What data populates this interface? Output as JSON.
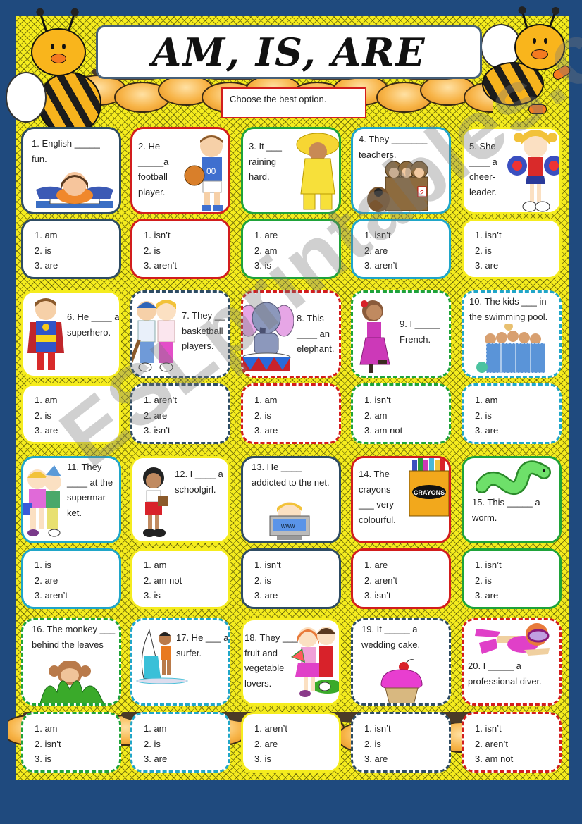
{
  "worksheet": {
    "title": "AM, IS, ARE",
    "instruction": "Choose the best option.",
    "watermark": "ESLprintables.com"
  },
  "colors": {
    "page_background": "#1f4a7e",
    "sheet_background": "#f5ec1e",
    "navy": "#2e4c63",
    "red": "#d21d1d",
    "green": "#1fa33a",
    "teal": "#20a6c8",
    "yellow": "#f5ec1e"
  },
  "questions": [
    {
      "number": 1,
      "prompt": "1. English _____ fun.",
      "picture": "girl-reading-book",
      "border_color": "navy",
      "border_style": "solid",
      "options": [
        "1. am",
        "2. is",
        "3. are"
      ]
    },
    {
      "number": 2,
      "prompt": "2. He _____a football player.",
      "picture": "boy-with-basketball",
      "border_color": "red",
      "border_style": "solid",
      "options": [
        "1. isn’t",
        "2. is",
        "3. aren’t"
      ]
    },
    {
      "number": 3,
      "prompt": "3. It ___ raining hard.",
      "picture": "child-in-raincoat",
      "border_color": "green",
      "border_style": "solid",
      "options": [
        "1. are",
        "2. am",
        "3. is"
      ]
    },
    {
      "number": 4,
      "prompt": "4. They _______ teachers.",
      "picture": "detectives-with-dog",
      "border_color": "teal",
      "border_style": "solid",
      "options": [
        "1. isn’t",
        "2. are",
        "3. aren’t"
      ]
    },
    {
      "number": 5,
      "prompt": "5. She ____ a cheer-leader.",
      "picture": "cheerleader",
      "border_color": "yellow",
      "border_style": "solid",
      "options": [
        "1. isn’t",
        "2. is",
        "3. are"
      ]
    },
    {
      "number": 6,
      "prompt": "6. He ____ a superhero.",
      "picture": "superhero-boy",
      "border_color": "yellow",
      "border_style": "solid",
      "options": [
        "1. am",
        "2. is",
        "3. are"
      ]
    },
    {
      "number": 7,
      "prompt": "7. They __ basketball players.",
      "picture": "baseball-kids",
      "border_color": "navy",
      "border_style": "dashed",
      "options": [
        "1. aren’t",
        "2. are",
        "3. isn’t"
      ]
    },
    {
      "number": 8,
      "prompt": "8. This ____ an elephant.",
      "picture": "circus-elephant",
      "border_color": "red",
      "border_style": "dashed",
      "options": [
        "1. am",
        "2. is",
        "3. are"
      ]
    },
    {
      "number": 9,
      "prompt": "9. I _____ French.",
      "picture": "flamenco-dancer",
      "border_color": "green",
      "border_style": "dashed",
      "options": [
        "1. isn’t",
        "2. am",
        "3. am not"
      ]
    },
    {
      "number": 10,
      "prompt": "10. The kids ___ in the swimming pool.",
      "picture": "kids-in-pool",
      "border_color": "teal",
      "border_style": "dashed",
      "options": [
        "1. am",
        "2. is",
        "3. are"
      ]
    },
    {
      "number": 11,
      "prompt": "11. They ____ at the supermar ket.",
      "picture": "shopping-kids",
      "border_color": "teal",
      "border_style": "solid",
      "options": [
        "1. is",
        "2. are",
        "3. aren’t"
      ]
    },
    {
      "number": 12,
      "prompt": "12. I ____ a schoolgirl.",
      "picture": "schoolgirl",
      "border_color": "yellow",
      "border_style": "solid",
      "options": [
        "1. am",
        "2. am not",
        "3. is"
      ]
    },
    {
      "number": 13,
      "prompt": "13. He ____ addicted to the net.",
      "picture": "kid-with-computer",
      "border_color": "navy",
      "border_style": "solid",
      "options": [
        "1. isn’t",
        "2. is",
        "3. are"
      ]
    },
    {
      "number": 14,
      "prompt": "14. The crayons ___ very colourful.",
      "picture": "crayon-box",
      "picture_label": "CRAYONS",
      "border_color": "red",
      "border_style": "solid",
      "options": [
        "1. are",
        "2. aren’t",
        "3. isn’t"
      ]
    },
    {
      "number": 15,
      "prompt": "15. This _____ a worm.",
      "picture": "green-worm",
      "border_color": "green",
      "border_style": "solid",
      "options": [
        "1. isn’t",
        "2. is",
        "3. are"
      ]
    },
    {
      "number": 16,
      "prompt": "16. The monkey ___ behind the leaves",
      "picture": "monkey-in-leaves",
      "border_color": "green",
      "border_style": "dashed",
      "options": [
        "1. am",
        "2. isn’t",
        "3. is"
      ]
    },
    {
      "number": 17,
      "prompt": "17. He ___ a surfer.",
      "picture": "windsurfer-boy",
      "border_color": "teal",
      "border_style": "dashed",
      "options": [
        "1. am",
        "2. is",
        "3. are"
      ]
    },
    {
      "number": 18,
      "prompt": "18. They ___ fruit and vegetable lovers.",
      "picture": "kids-with-watermelon",
      "border_color": "yellow",
      "border_style": "solid",
      "options": [
        "1. aren’t",
        "2. are",
        "3. is"
      ]
    },
    {
      "number": 19,
      "prompt": "19. It _____ a wedding cake.",
      "picture": "cupcake",
      "border_color": "navy",
      "border_style": "dashed",
      "options": [
        "1. isn’t",
        "2. is",
        "3. are"
      ]
    },
    {
      "number": 20,
      "prompt": "20. I _____ a professional diver.",
      "picture": "diver",
      "border_color": "red",
      "border_style": "dashed",
      "options": [
        "1. isn’t",
        "2. aren’t",
        "3. am not"
      ]
    }
  ]
}
